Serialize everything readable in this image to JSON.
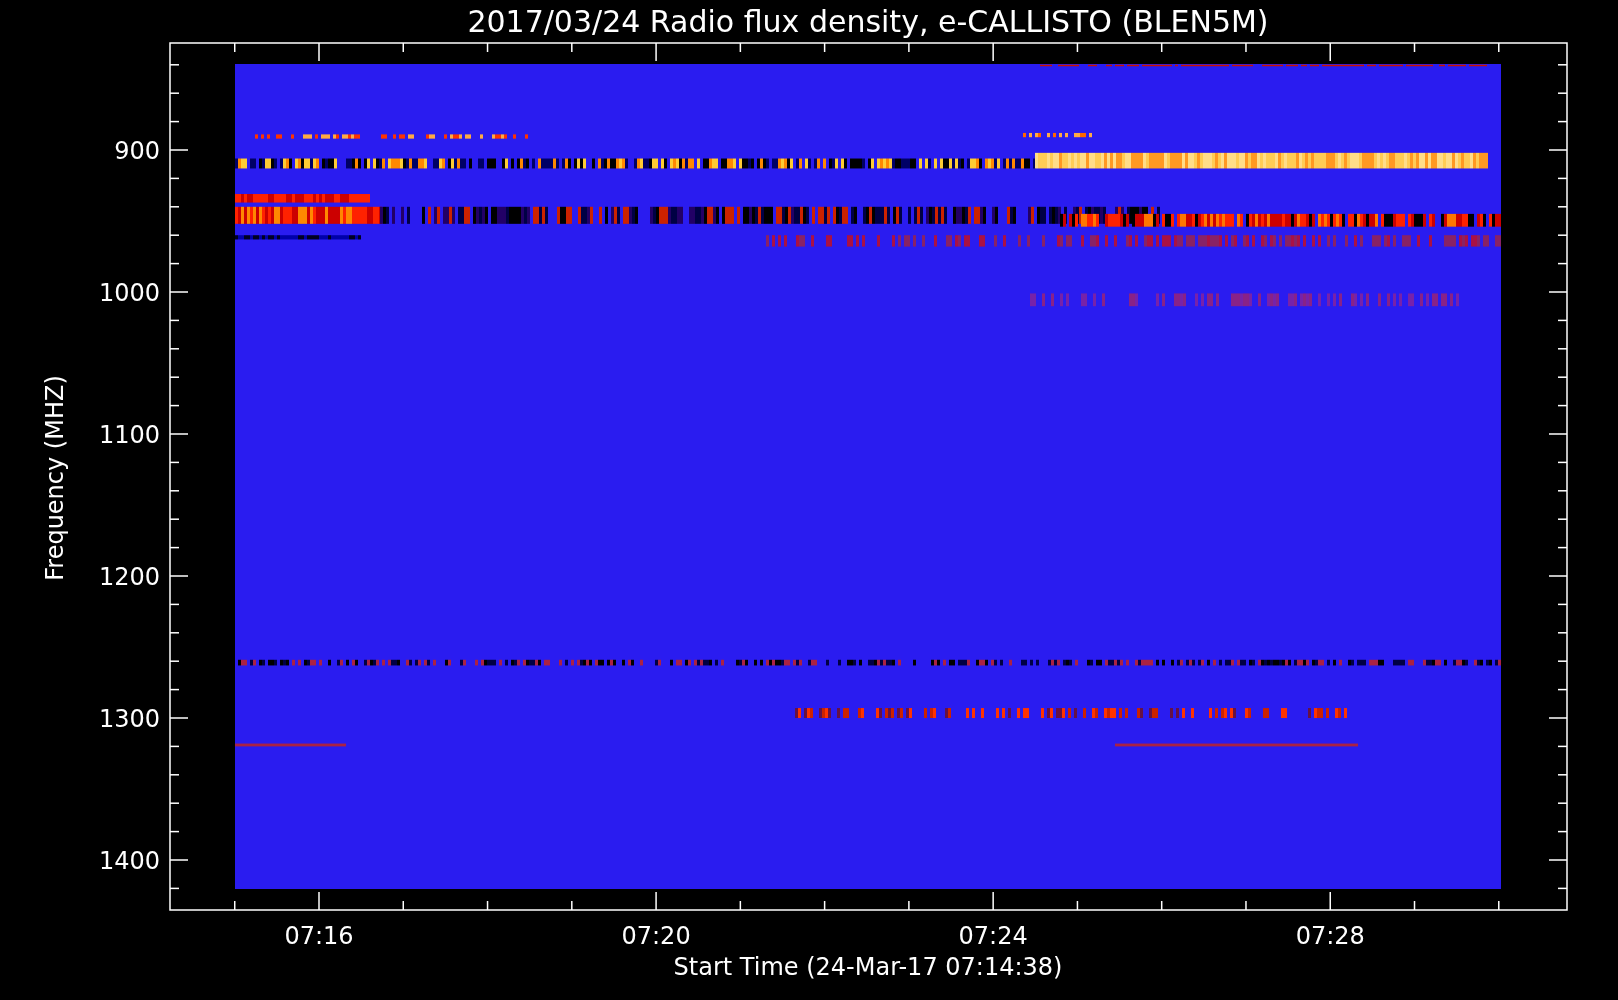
{
  "title": "2017/03/24  Radio flux density, e-CALLISTO (BLEN5M)",
  "y_axis": {
    "label": "Frequency (MHZ)",
    "ticks": [
      "900",
      "1000",
      "1100",
      "1200",
      "1300",
      "1400"
    ]
  },
  "x_axis": {
    "label": "Start Time (24-Mar-17 07:14:38)",
    "ticks": [
      "07:16",
      "07:20",
      "07:24",
      "07:28"
    ]
  }
}
